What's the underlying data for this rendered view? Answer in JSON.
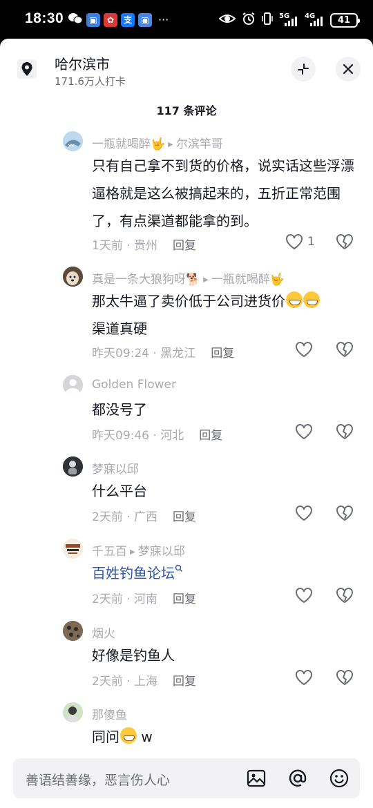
{
  "status_bar": {
    "time": "18:30",
    "more": "···",
    "network1": "5G",
    "network2": "4G",
    "battery": "41"
  },
  "header": {
    "location_title": "哈尔滨市",
    "location_sub": "171.6万人打卡",
    "comment_count": "117 条评论"
  },
  "comments": [
    {
      "name": "一瓶就喝醉🤟",
      "reply_to": "尔滨竿哥",
      "text": "只有自己拿不到货的价格，说实话这些浮漂逼格就是这么被搞起来的，五折正常范围了，有点渠道都能拿的到。",
      "time": "1天前 · 贵州",
      "reply": "回复",
      "likes": "1"
    },
    {
      "name": "真是一条大狼狗呀🐕",
      "reply_to": "一瓶就喝醉🤟",
      "text": "那太牛逼了卖价低于公司进货价",
      "text2": "渠道真硬",
      "time": "昨天09:24 · 黑龙江",
      "reply": "回复",
      "likes": ""
    },
    {
      "name": "Golden Flower",
      "reply_to": "",
      "text": "都没号了",
      "time": "昨天09:46 · 河北",
      "reply": "回复",
      "likes": ""
    },
    {
      "name": "梦寐以邱",
      "reply_to": "",
      "text": "什么平台",
      "time": "2天前 · 广西",
      "reply": "回复",
      "likes": ""
    },
    {
      "name": "千五百",
      "reply_to": "梦寐以邱",
      "text": "百姓钓鱼论坛",
      "time": "2天前 · 河南",
      "reply": "回复",
      "likes": ""
    },
    {
      "name": "烟火",
      "reply_to": "",
      "text": "好像是钓鱼人",
      "time": "2天前 · 上海",
      "reply": "回复",
      "likes": ""
    },
    {
      "name": "那傻鱼",
      "reply_to": "",
      "text": "同问",
      "text_suffix": "w",
      "time": "",
      "reply": "",
      "likes": ""
    }
  ],
  "input": {
    "placeholder": "善语结善缘，恶言伤人心"
  },
  "colors": {
    "accent_link": "#3355a6",
    "muted": "#a9abb1",
    "text": "#161823",
    "input_bg": "#f2f2f4"
  }
}
